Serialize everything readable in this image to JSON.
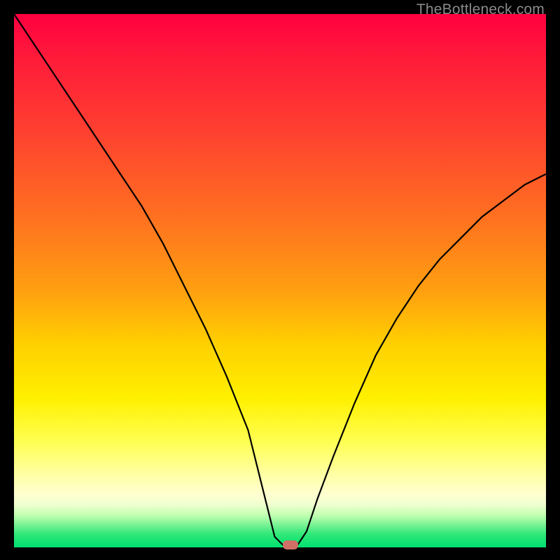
{
  "watermark": "TheBottleneck.com",
  "chart_data": {
    "type": "line",
    "title": "",
    "xlabel": "",
    "ylabel": "",
    "x_range": [
      0,
      100
    ],
    "y_range": [
      0,
      100
    ],
    "series": [
      {
        "name": "bottleneck-curve",
        "x": [
          0,
          4,
          8,
          12,
          16,
          20,
          24,
          28,
          32,
          36,
          40,
          44,
          47,
          49,
          51,
          53,
          55,
          57,
          60,
          64,
          68,
          72,
          76,
          80,
          84,
          88,
          92,
          96,
          100
        ],
        "y": [
          100,
          94,
          88,
          82,
          76,
          70,
          64,
          57,
          49,
          41,
          32,
          22,
          10,
          2,
          0,
          0,
          3,
          9,
          17,
          27,
          36,
          43,
          49,
          54,
          58,
          62,
          65,
          68,
          70
        ]
      }
    ],
    "marker": {
      "x": 52,
      "y": 0,
      "color": "#cf6f65"
    },
    "gradient_stops": [
      {
        "pct": 0,
        "color": "#ff0040"
      },
      {
        "pct": 38,
        "color": "#ff7020"
      },
      {
        "pct": 72,
        "color": "#fff000"
      },
      {
        "pct": 90,
        "color": "#ffffd0"
      },
      {
        "pct": 100,
        "color": "#00e070"
      }
    ]
  }
}
